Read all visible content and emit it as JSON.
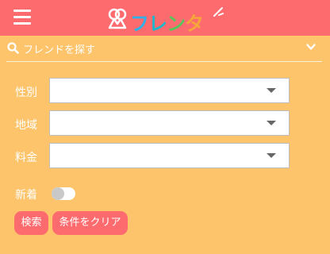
{
  "header": {
    "logo_text": [
      "フ",
      "レ",
      "ン",
      "タ"
    ],
    "menu_icon": "hamburger-icon",
    "colors": {
      "header_bg": "#fe6b6e"
    }
  },
  "search": {
    "title": "フレンドを探す",
    "icon": "search-icon",
    "toggle_icon": "chevron-down-icon"
  },
  "form": {
    "fields": [
      {
        "label": "性別",
        "value": ""
      },
      {
        "label": "地域",
        "value": ""
      },
      {
        "label": "料金",
        "value": ""
      }
    ],
    "new_label": "新着",
    "new_toggle_on": false
  },
  "buttons": {
    "search": "検索",
    "clear": "条件をクリア"
  },
  "colors": {
    "background": "#fdc46b",
    "accent": "#fe6b6e"
  }
}
